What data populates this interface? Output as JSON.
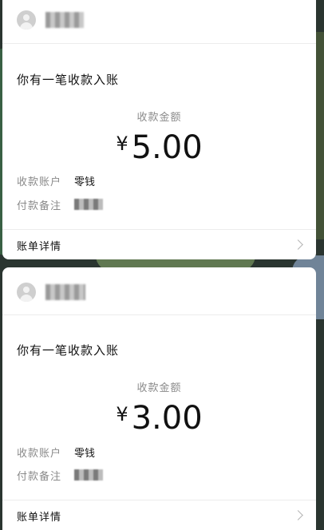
{
  "messages": [
    {
      "title": "你有一笔收款入账",
      "amount_label": "收款金额",
      "currency": "¥",
      "amount": "5.00",
      "account_label": "收款账户",
      "account_value": "零钱",
      "note_label": "付款备注",
      "details_link": "账单详情"
    },
    {
      "title": "你有一笔收款入账",
      "amount_label": "收款金额",
      "currency": "¥",
      "amount": "3.00",
      "account_label": "收款账户",
      "account_value": "零钱",
      "note_label": "付款备注",
      "details_link": "账单详情"
    }
  ]
}
